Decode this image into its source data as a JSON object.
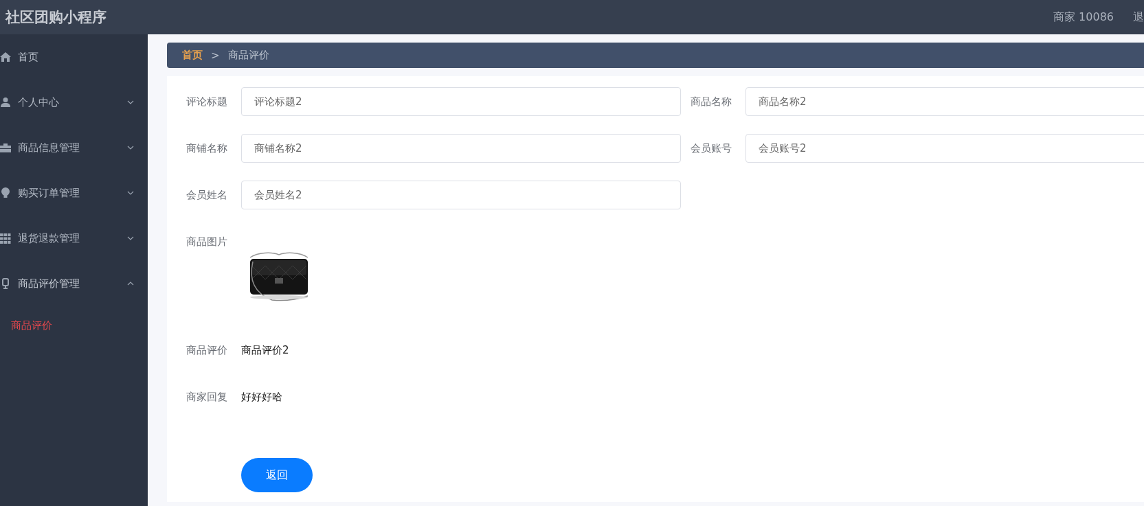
{
  "header": {
    "title": "社区团购小程序",
    "user": "商家 10086",
    "logout": "退"
  },
  "sidebar": {
    "items": [
      {
        "kind": "link",
        "label": "首页"
      },
      {
        "kind": "group",
        "label": "个人中心",
        "expanded": false
      },
      {
        "kind": "group",
        "label": "商品信息管理",
        "expanded": false
      },
      {
        "kind": "group",
        "label": "购买订单管理",
        "expanded": false
      },
      {
        "kind": "group",
        "label": "退货退款管理",
        "expanded": false
      },
      {
        "kind": "group",
        "label": "商品评价管理",
        "expanded": true,
        "children": [
          {
            "label": "商品评价",
            "selected": true
          }
        ]
      }
    ]
  },
  "breadcrumb": {
    "home": "首页",
    "separator": ">",
    "current": "商品评价"
  },
  "form": {
    "fields": [
      {
        "kind": "input",
        "label": "评论标题",
        "value": "评论标题2"
      },
      {
        "kind": "input",
        "label": "商品名称",
        "value": "商品名称2"
      },
      {
        "kind": "input",
        "label": "商铺名称",
        "value": "商铺名称2"
      },
      {
        "kind": "input",
        "label": "会员账号",
        "value": "会员账号2"
      },
      {
        "kind": "input",
        "label": "会员姓名",
        "value": "会员姓名2"
      },
      {
        "label": "商品图片"
      },
      {
        "kind": "text",
        "label": "商品评价",
        "value": "商品评价2"
      },
      {
        "kind": "text",
        "label": "商家回复",
        "value": "好好好哈"
      }
    ],
    "button": "返回"
  }
}
